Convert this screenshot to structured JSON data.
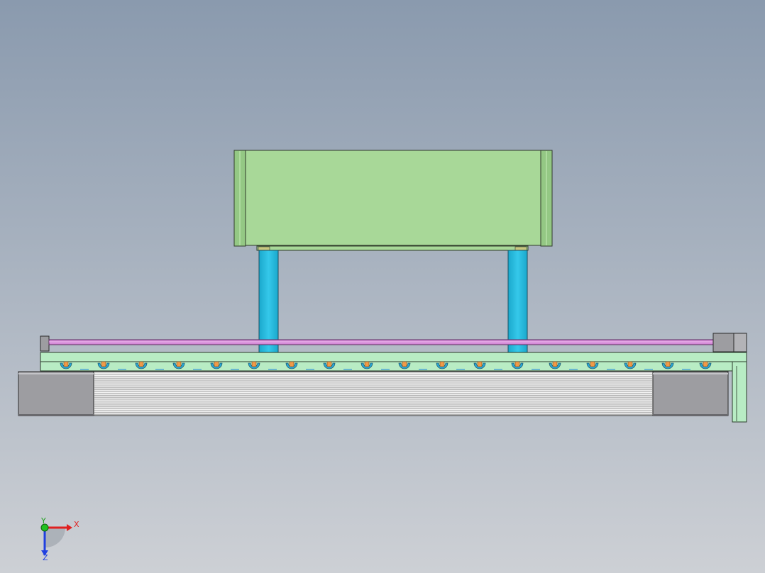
{
  "viewport": {
    "background_top": "#8a9aae",
    "background_bottom": "#cdd0d5"
  },
  "colors": {
    "box_fill": "#a8d898",
    "box_edge": "#2f3a2a",
    "leg_fill": "#2fc0e0",
    "rod_fill": "#d58ad8",
    "plate_fill": "#b8ecc4",
    "wheel_outer": "#27a9d7",
    "wheel_inner": "#f19a48",
    "roller_light": "#f2f2f2",
    "roller_dark": "#b0b0b0",
    "motor_fill": "#9d9da1",
    "motor_edge": "#2a2a2a",
    "axis_x": "#e02020",
    "axis_y": "#20c020",
    "axis_z": "#2040e0"
  },
  "model": {
    "wheel_count": 18,
    "roller_stripes": 22
  },
  "triad": {
    "x_label": "X",
    "y_label": "Y",
    "z_label": "Z"
  }
}
